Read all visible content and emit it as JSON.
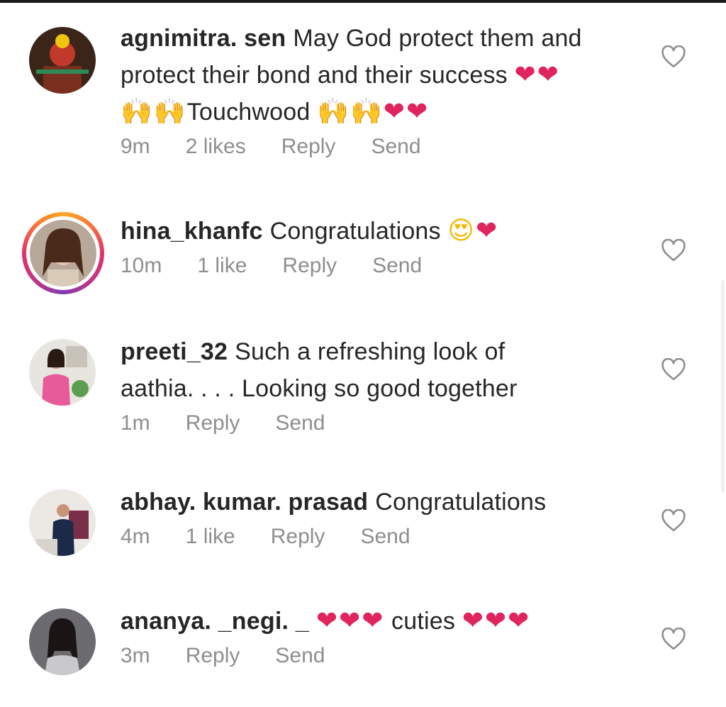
{
  "comments": [
    {
      "username": "agnimitra. sen",
      "lines": [
        "May God protect them and",
        "protect their bond and their success"
      ],
      "emoji_line1": "❤❤",
      "line3_pre_emoji": "🙌🙌",
      "line3_text": "Touchwood",
      "line3_post_emoji": "🙌🙌",
      "line3_hearts": "❤❤",
      "time": "9m",
      "likes": "2 likes",
      "reply": "Reply",
      "send": "Send"
    },
    {
      "username": "hina_khanfc",
      "text": "Congratulations",
      "emoji": "😍",
      "heart": "❤",
      "time": "10m",
      "likes": "1 like",
      "reply": "Reply",
      "send": "Send"
    },
    {
      "username": "preeti_32",
      "line1": "Such a refreshing look of",
      "line2": "aathia. . . .  Looking so good together",
      "time": "1m",
      "reply": "Reply",
      "send": "Send"
    },
    {
      "username": "abhay. kumar. prasad",
      "text": "Congratulations",
      "time": "4m",
      "likes": "1 like",
      "reply": "Reply",
      "send": "Send"
    },
    {
      "username": "ananya. _negi. _",
      "hearts_before": "❤❤❤",
      "text": "cuties",
      "hearts_after": "❤❤❤",
      "time": "3m",
      "reply": "Reply",
      "send": "Send"
    }
  ],
  "colors": {
    "text": "#262626",
    "meta": "#8e8e8e",
    "heart_emoji": "#e0245e",
    "like_outline": "#8e8e8e"
  },
  "icons": {
    "like": "heart-outline-icon"
  }
}
